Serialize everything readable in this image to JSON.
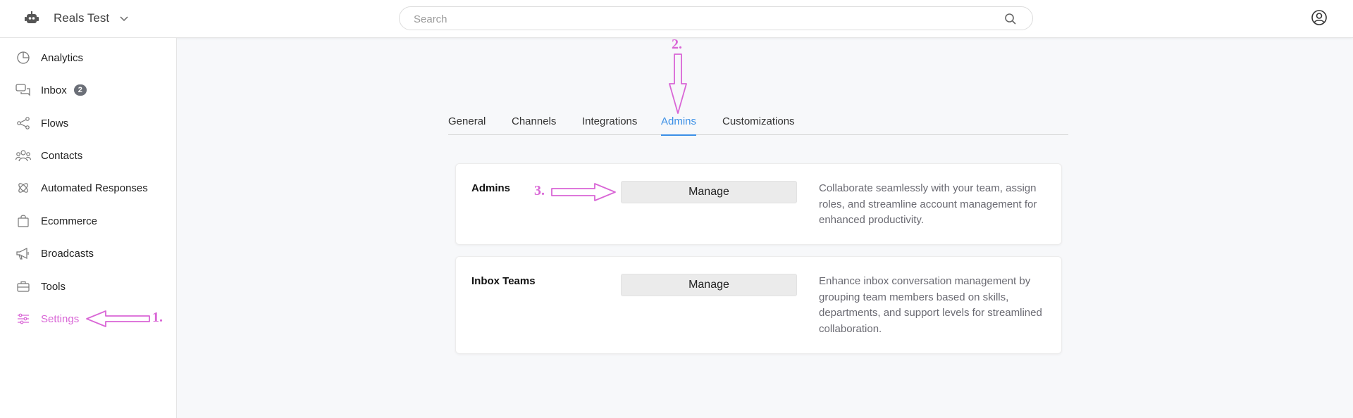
{
  "header": {
    "workspace_name": "Reals Test",
    "search_placeholder": "Search"
  },
  "sidebar": {
    "items": [
      {
        "label": "Analytics",
        "icon": "analytics-icon"
      },
      {
        "label": "Inbox",
        "icon": "inbox-icon",
        "badge": "2"
      },
      {
        "label": "Flows",
        "icon": "flows-icon"
      },
      {
        "label": "Contacts",
        "icon": "contacts-icon"
      },
      {
        "label": "Automated Responses",
        "icon": "automation-icon"
      },
      {
        "label": "Ecommerce",
        "icon": "shopping-bag-icon"
      },
      {
        "label": "Broadcasts",
        "icon": "megaphone-icon"
      },
      {
        "label": "Tools",
        "icon": "toolbox-icon"
      },
      {
        "label": "Settings",
        "icon": "sliders-icon",
        "active": true
      }
    ]
  },
  "tabs": [
    {
      "label": "General"
    },
    {
      "label": "Channels"
    },
    {
      "label": "Integrations"
    },
    {
      "label": "Admins",
      "active": true
    },
    {
      "label": "Customizations"
    }
  ],
  "cards": [
    {
      "title": "Admins",
      "button_label": "Manage",
      "description": "Collaborate seamlessly with your team, assign roles, and streamline account management for enhanced productivity."
    },
    {
      "title": "Inbox Teams",
      "button_label": "Manage",
      "description": "Enhance inbox conversation management by grouping team members based on skills, departments, and support levels for streamlined collaboration."
    }
  ],
  "annotations": {
    "step1": "1.",
    "step2": "2.",
    "step3": "3."
  },
  "colors": {
    "accent_active_tab": "#3a8fe6",
    "annotation_magenta": "#d966d6",
    "badge": "#6b6f77"
  }
}
